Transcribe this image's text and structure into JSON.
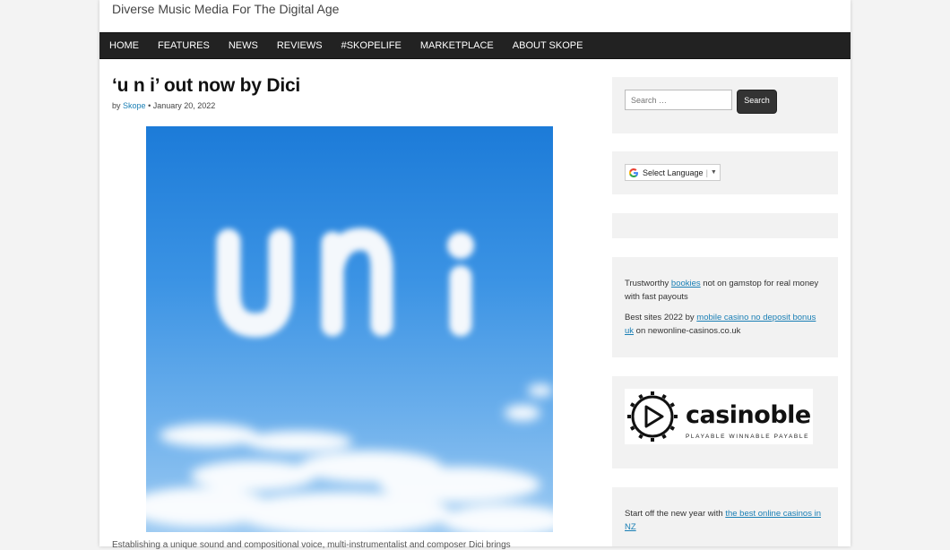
{
  "site": {
    "tagline": "Diverse Music Media For The Digital Age"
  },
  "nav": {
    "items": [
      {
        "label": "HOME"
      },
      {
        "label": "FEATURES"
      },
      {
        "label": "NEWS"
      },
      {
        "label": "REVIEWS"
      },
      {
        "label": "#SKOPELIFE"
      },
      {
        "label": "MARKETPLACE"
      },
      {
        "label": "ABOUT SKOPE"
      }
    ]
  },
  "post": {
    "title": "‘u n i’ out now by Dici",
    "by": "by",
    "author": "Skope",
    "date": "January 20, 2022",
    "image_text": "u n i",
    "truncated_text": "Establishing a unique sound and compositional voice, multi-instrumentalist and composer Dici brings"
  },
  "sidebar": {
    "search": {
      "placeholder": "Search …",
      "button": "Search"
    },
    "language": {
      "label": "Select Language",
      "arrow": "▼"
    },
    "links": {
      "p1_pre": "Trustworthy ",
      "p1_link": "bookies",
      "p1_post": " not on gamstop for real money with fast payouts",
      "p2_pre": "Best sites 2022 by ",
      "p2_link": "mobile casino no deposit bonus uk",
      "p2_post": " on newonline-casinos.co.uk"
    },
    "logo": {
      "word": "casinoble",
      "sub": "PLAYABLE WINNABLE PAYABLE"
    },
    "bottom": {
      "pre": "Start off the new year with ",
      "link": "the best online casinos in NZ"
    }
  }
}
